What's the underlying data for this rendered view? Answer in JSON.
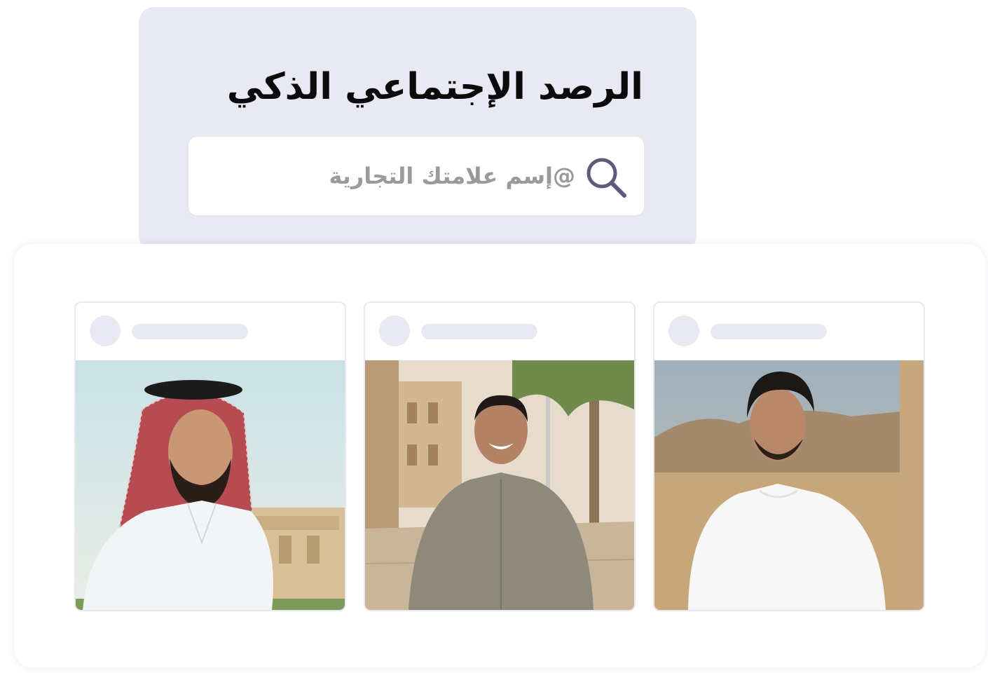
{
  "header": {
    "title": "الرصد الإجتماعي الذكي"
  },
  "search": {
    "placeholder": "@إسم علامتك التجارية",
    "value": ""
  },
  "colors": {
    "panel_background": "#e9e9f3",
    "skeleton": "#e9e9f3",
    "search_icon": "#5c5c7a",
    "title_text": "#0b0b0b",
    "placeholder_text": "#9a9a9a"
  },
  "feed": {
    "posts": [
      {
        "image": "man-in-red-shemagh-and-white-thobe-photo"
      },
      {
        "image": "smiling-man-in-grey-thobe-street-photo"
      },
      {
        "image": "man-in-white-tshirt-desert-photo"
      }
    ]
  }
}
